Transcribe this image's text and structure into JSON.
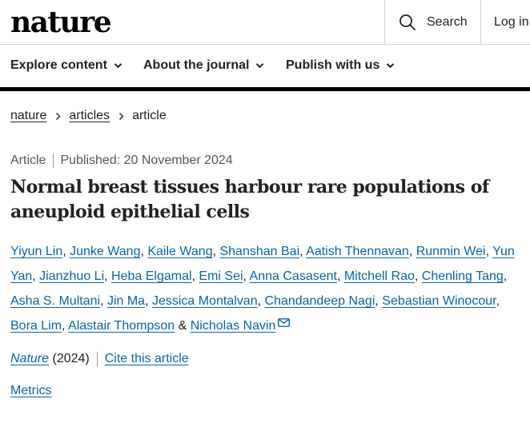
{
  "header": {
    "logo": "nature",
    "search_label": "Search",
    "search_icon": "search-icon",
    "login_label": "Log in"
  },
  "nav": {
    "items": [
      {
        "label": "Explore content",
        "icon": "chevron-down-icon"
      },
      {
        "label": "About the journal",
        "icon": "chevron-down-icon"
      },
      {
        "label": "Publish with us",
        "icon": "chevron-down-icon"
      }
    ]
  },
  "breadcrumb": {
    "items": [
      "nature",
      "articles",
      "article"
    ],
    "separator_icon": "chevron-right-icon"
  },
  "article": {
    "type": "Article",
    "published": "Published: 20 November 2024",
    "title_line1": "Normal breast tissues harbour rare populations of",
    "title_line2": "aneuploid epithelial cells",
    "authors": [
      "Yiyun Lin",
      "Junke Wang",
      "Kaile Wang",
      "Shanshan Bai",
      "Aatish Thennavan",
      "Runmin Wei",
      "Yun",
      "Yan",
      "Jianzhuo Li",
      "Heba Elgamal",
      "Emi Sei",
      "Anna Casasent",
      "Mitchell Rao",
      "Chenling Tang",
      "Asha S. Multani",
      "Jin Ma",
      "Jessica Montalvan",
      "Chandandeep Nagi",
      "Sebastian Winocour",
      "Bora Lim",
      "Alastair Thompson",
      "Nicholas Navin"
    ],
    "and_text": "&",
    "contact_icon": "mail-icon",
    "journal": "Nature",
    "year": "(2024)",
    "cite_label": "Cite this article",
    "metrics_label": "Metrics"
  },
  "colors": {
    "link": "#0a63ad",
    "text": "#222222",
    "muted": "#555555",
    "rule": "#000000"
  }
}
